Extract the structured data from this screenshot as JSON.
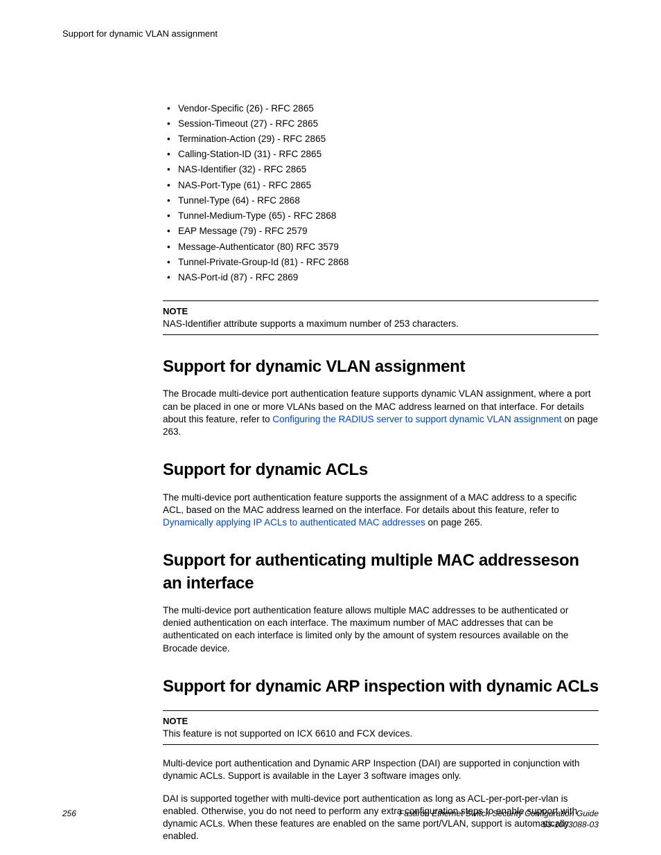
{
  "runningHeader": "Support for dynamic VLAN assignment",
  "bullets": [
    "Vendor-Specific (26) - RFC 2865",
    "Session-Timeout (27) - RFC 2865",
    "Termination-Action (29) - RFC 2865",
    "Calling-Station-ID (31) - RFC 2865",
    "NAS-Identifier (32) - RFC 2865",
    "NAS-Port-Type (61) - RFC 2865",
    "Tunnel-Type (64) - RFC 2868",
    "Tunnel-Medium-Type (65) - RFC 2868",
    "EAP Message (79) - RFC 2579",
    "Message-Authenticator (80) RFC 3579",
    "Tunnel-Private-Group-Id (81) - RFC 2868",
    "NAS-Port-id (87) - RFC 2869"
  ],
  "note1": {
    "label": "NOTE",
    "text": "NAS-Identifier attribute supports a maximum number of 253 characters."
  },
  "sec1": {
    "title": "Support for dynamic VLAN assignment",
    "p1a": "The Brocade multi-device port authentication feature supports dynamic VLAN assignment, where a port can be placed in one or more VLANs based on the MAC address learned on that interface. For details about this feature, refer to ",
    "link": "Configuring the RADIUS server to support dynamic VLAN assignment",
    "p1b": " on page 263."
  },
  "sec2": {
    "title": "Support for dynamic ACLs",
    "p1a": "The multi-device port authentication feature supports the assignment of a MAC address to a specific ACL, based on the MAC address learned on the interface. For details about this feature, refer to ",
    "link": "Dynamically applying IP ACLs to authenticated MAC addresses",
    "p1b": " on page 265."
  },
  "sec3": {
    "title": "Support for authenticating multiple MAC addresseson an interface",
    "p1": "The multi-device port authentication feature allows multiple MAC addresses to be authenticated or denied authentication on each interface. The maximum number of MAC addresses that can be authenticated on each interface is limited only by the amount of system resources available on the Brocade device."
  },
  "sec4": {
    "title": "Support for dynamic ARP inspection with dynamic ACLs",
    "note": {
      "label": "NOTE",
      "text": "This feature is not supported on ICX 6610 and FCX devices."
    },
    "p1": "Multi-device port authentication and Dynamic ARP Inspection (DAI) are supported in conjunction with dynamic ACLs. Support is available in the Layer 3 software images only.",
    "p2": "DAI is supported together with multi-device port authentication as long as ACL-per-port-per-vlan is enabled. Otherwise, you do not need to perform any extra configuration steps to enable support with dynamic ACLs. When these features are enabled on the same port/VLAN, support is automatically enabled."
  },
  "footer": {
    "page": "256",
    "title": "FastIron Ethernet Switch Security Configuration Guide",
    "docnum": "53-1003088-03"
  }
}
